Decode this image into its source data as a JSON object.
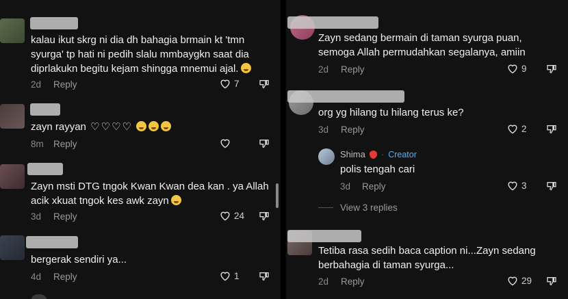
{
  "left_comments": [
    {
      "text_lines": [
        "kalau ikut skrg ni dia dh bahagia brmain kt 'tmn",
        "syurga' tp hati ni pedih slalu mmbaygkn saat dia",
        "diprlakukn begitu kejam shingga mnemui ajal."
      ],
      "time": "2d",
      "reply": "Reply",
      "likes": "7"
    },
    {
      "text_lines": [
        "zayn rayyan"
      ],
      "time": "8m",
      "reply": "Reply",
      "likes": ""
    },
    {
      "text_lines": [
        "Zayn msti DTG tngok Kwan Kwan dea kan . ya Allah",
        "acik xkuat tngok kes awk zayn"
      ],
      "time": "3d",
      "reply": "Reply",
      "likes": "24"
    },
    {
      "text_lines": [
        "bergerak sendiri ya..."
      ],
      "time": "4d",
      "reply": "Reply",
      "likes": "1"
    }
  ],
  "right_comments": [
    {
      "text_lines": [
        "Zayn sedang bermain di taman syurga puan,",
        "semoga Allah permudahkan segalanya, amiin"
      ],
      "time": "2d",
      "reply": "Reply",
      "likes": "9"
    },
    {
      "text_lines": [
        "org yg hilang tu hilang terus ke?"
      ],
      "time": "3d",
      "reply": "Reply",
      "likes": "2"
    },
    {
      "text_lines": [
        "Tetiba rasa sedih baca caption ni...Zayn sedang",
        "berbahagia di taman syurga..."
      ],
      "time": "2d",
      "reply": "Reply",
      "likes": "29"
    }
  ],
  "nested_reply": {
    "author": "Shima",
    "badge": "Creator",
    "text": "polis tengah cari",
    "time": "3d",
    "reply": "Reply",
    "likes": "3"
  },
  "view_replies": "View 3 replies",
  "icons": {
    "like": "heart-outline-icon",
    "dislike": "thumbs-down-icon"
  },
  "colors": {
    "background": "#121212",
    "creator": "#4bb3ff",
    "text": "#f0f0f0",
    "meta": "#8a8a8a"
  }
}
